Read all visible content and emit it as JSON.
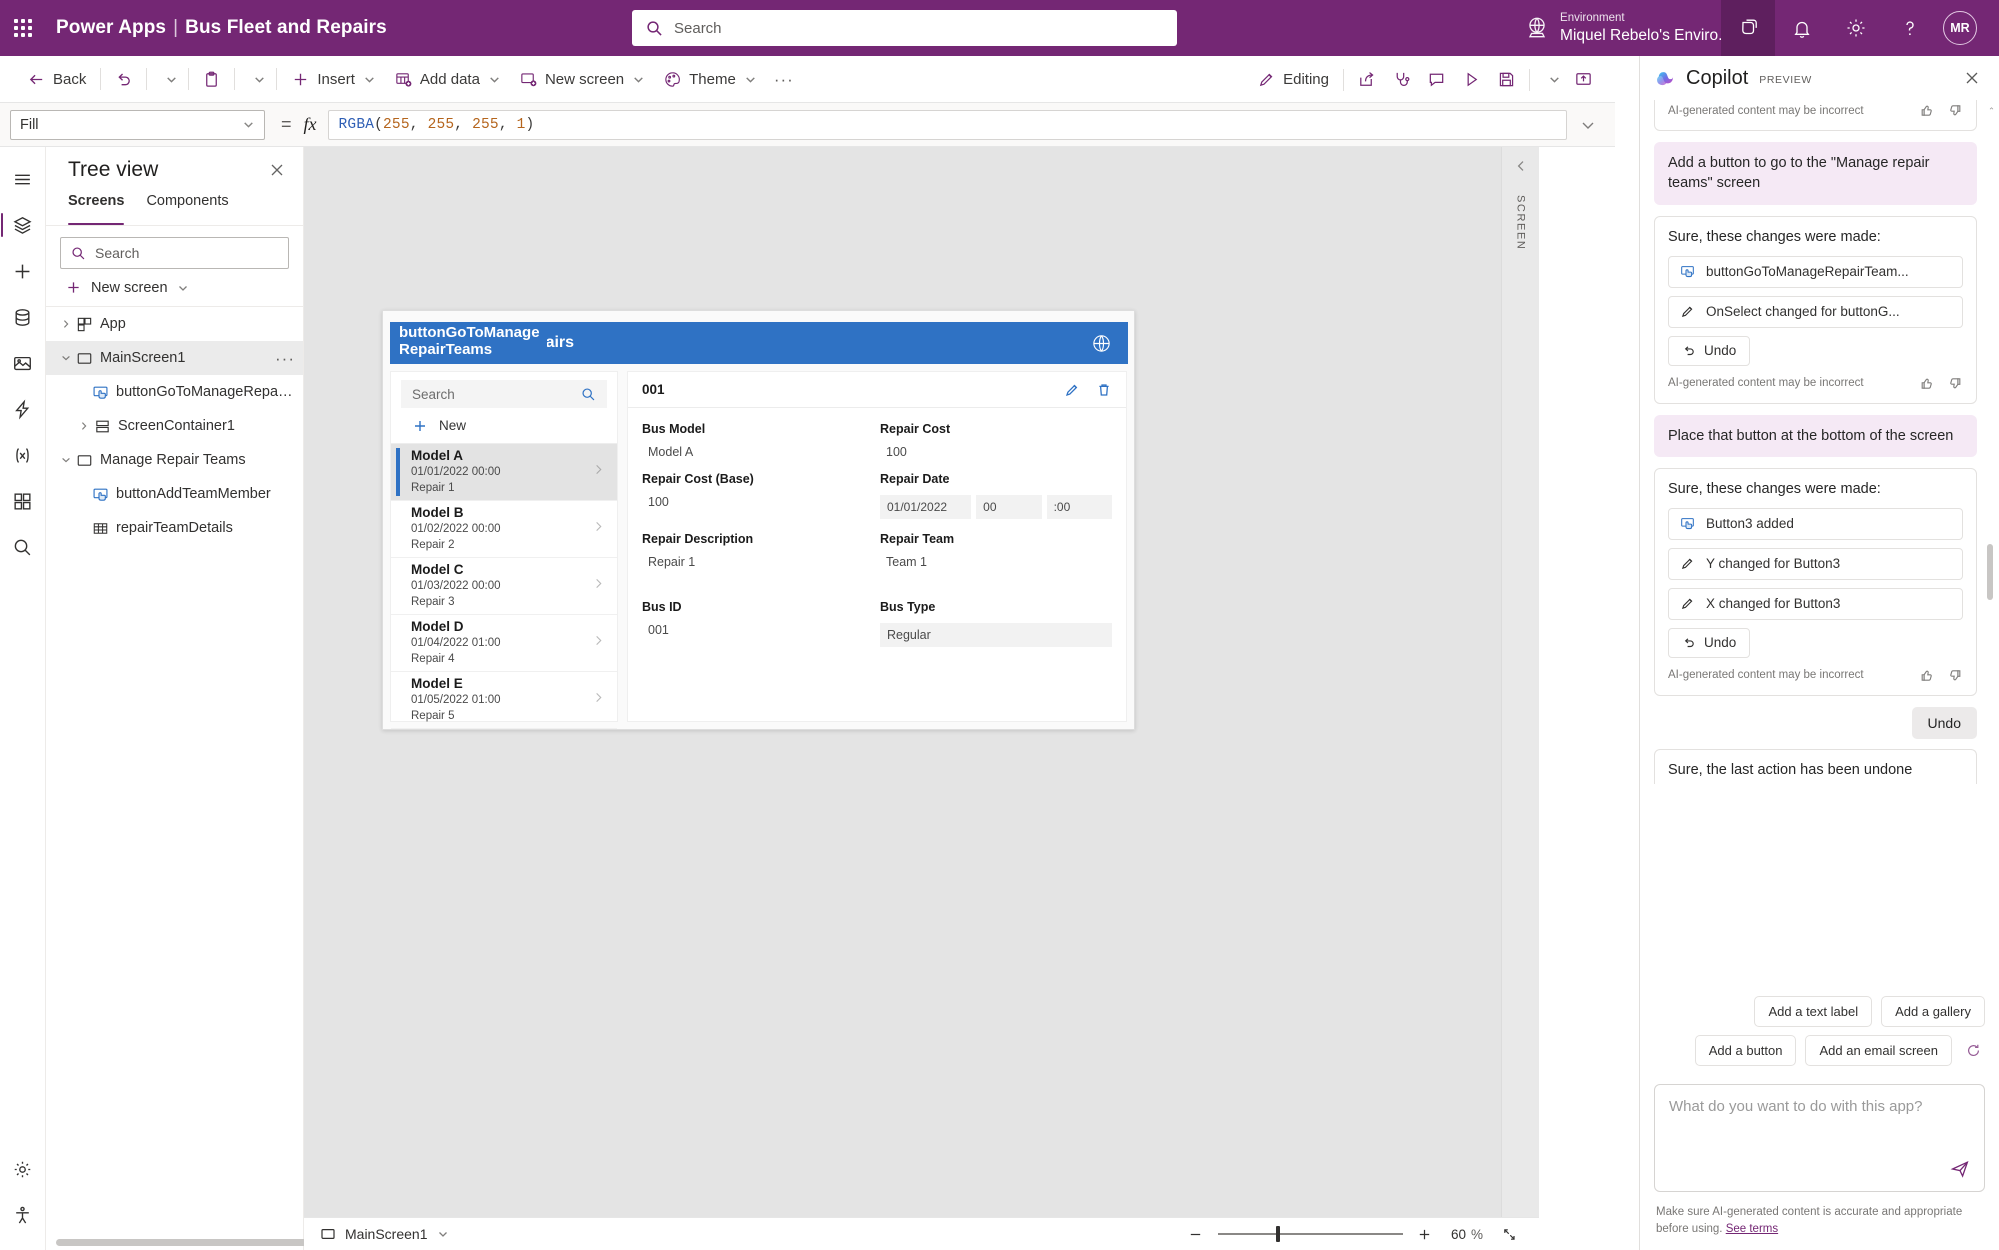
{
  "topbar": {
    "waffle_label": "app-launcher",
    "product": "Power Apps",
    "separator": "|",
    "app_name": "Bus Fleet and Repairs",
    "search_placeholder": "Search",
    "environment_label": "Environment",
    "environment_name": "Miquel Rebelo's Enviro...",
    "avatar_initials": "MR"
  },
  "commandbar": {
    "back": "Back",
    "insert": "Insert",
    "add_data": "Add data",
    "new_screen": "New screen",
    "theme": "Theme",
    "more": "···",
    "editing": "Editing"
  },
  "formulabar": {
    "property": "Fill",
    "equals": "=",
    "fx": "fx",
    "formula_fn": "RGBA",
    "formula_args": [
      "255",
      "255",
      "255",
      "1"
    ],
    "formula_full": "RGBA(255, 255, 255, 1)"
  },
  "treeview": {
    "title": "Tree view",
    "tabs": [
      {
        "label": "Screens",
        "selected": true
      },
      {
        "label": "Components",
        "selected": false
      }
    ],
    "search_placeholder": "Search",
    "new_screen": "New screen",
    "nodes": [
      {
        "label": "App",
        "depth": 0,
        "icon": "app-icon",
        "arrow": "collapsed",
        "selected": false,
        "menu": false
      },
      {
        "label": "MainScreen1",
        "depth": 0,
        "icon": "screen-icon",
        "arrow": "expanded",
        "selected": true,
        "menu": true
      },
      {
        "label": "buttonGoToManageRepairTeams",
        "depth": 2,
        "icon": "button-icon",
        "arrow": "none",
        "selected": false,
        "menu": false
      },
      {
        "label": "ScreenContainer1",
        "depth": 1,
        "icon": "container-icon",
        "arrow": "collapsed",
        "selected": false,
        "menu": false
      },
      {
        "label": "Manage Repair Teams",
        "depth": 0,
        "icon": "screen-icon",
        "arrow": "expanded",
        "selected": false,
        "menu": false
      },
      {
        "label": "buttonAddTeamMember",
        "depth": 2,
        "icon": "button-icon",
        "arrow": "none",
        "selected": false,
        "menu": false
      },
      {
        "label": "repairTeamDetails",
        "depth": 2,
        "icon": "table-icon",
        "arrow": "none",
        "selected": false,
        "menu": false
      }
    ]
  },
  "canvas": {
    "collapse_label": "SCREEN",
    "app_header_title": "Bus Fleet and Repairs",
    "selected_control_label": "buttonGoToManageRepairTeams",
    "gallery": {
      "search_placeholder": "Search",
      "new_label": "New",
      "items": [
        {
          "title": "Model A",
          "date": "01/01/2022 00:00",
          "repair": "Repair 1",
          "selected": true
        },
        {
          "title": "Model B",
          "date": "01/02/2022 00:00",
          "repair": "Repair 2",
          "selected": false
        },
        {
          "title": "Model C",
          "date": "01/03/2022 00:00",
          "repair": "Repair 3",
          "selected": false
        },
        {
          "title": "Model D",
          "date": "01/04/2022 01:00",
          "repair": "Repair 4",
          "selected": false
        },
        {
          "title": "Model E",
          "date": "01/05/2022 01:00",
          "repair": "Repair 5",
          "selected": false
        }
      ]
    },
    "form": {
      "record_id": "001",
      "fields": [
        {
          "label": "Bus Model",
          "value": "Model A",
          "style": "plain"
        },
        {
          "label": "Repair Cost",
          "value": "100",
          "style": "plain"
        },
        {
          "label": "Repair Cost (Base)",
          "value": "100",
          "style": "plain"
        },
        {
          "label": "Repair Date",
          "value": "01/01/2022",
          "style": "date",
          "hour": "00",
          "minute": ":00"
        },
        {
          "label": "Repair Description",
          "value": "Repair 1",
          "style": "plain"
        },
        {
          "label": "Repair Team",
          "value": "Team 1",
          "style": "plain"
        },
        {
          "label": "Bus ID",
          "value": "001",
          "style": "plain"
        },
        {
          "label": "Bus Type",
          "value": "Regular",
          "style": "filled"
        }
      ]
    }
  },
  "canvas_footer": {
    "screen_name": "MainScreen1",
    "zoom_value": "60",
    "zoom_unit": "%"
  },
  "copilot": {
    "title": "Copilot",
    "badge": "PREVIEW",
    "disclaimer": "AI-generated content may be incorrect",
    "messages": [
      {
        "kind": "partial_card",
        "disclaimer": "AI-generated content may be incorrect"
      },
      {
        "kind": "user",
        "text": "Add a button to go to the \"Manage repair teams\" screen"
      },
      {
        "kind": "assistant",
        "heading": "Sure, these changes were made:",
        "changes": [
          {
            "icon": "button-icon",
            "text": "buttonGoToManageRepairTeam..."
          },
          {
            "icon": "pencil-icon",
            "text": "OnSelect changed for buttonG..."
          }
        ],
        "undo": "Undo",
        "disclaimer": "AI-generated content may be incorrect"
      },
      {
        "kind": "user",
        "text": "Place that button at the bottom of the screen"
      },
      {
        "kind": "assistant",
        "heading": "Sure, these changes were made:",
        "changes": [
          {
            "icon": "button-icon",
            "text": "Button3 added"
          },
          {
            "icon": "pencil-icon",
            "text": "Y changed for Button3"
          },
          {
            "icon": "pencil-icon",
            "text": "X changed for Button3"
          }
        ],
        "undo": "Undo",
        "disclaimer": "AI-generated content may be incorrect"
      },
      {
        "kind": "undo_pill",
        "text": "Undo"
      },
      {
        "kind": "assistant_plain",
        "text": "Sure, the last action has been undone"
      }
    ],
    "suggestions_row1": [
      "Add a text label",
      "Add a gallery"
    ],
    "suggestions_row2": [
      "Add a button",
      "Add an email screen"
    ],
    "input_placeholder": "What do you want to do with this app?",
    "footer_text": "Make sure AI-generated content is accurate and appropriate before using.",
    "footer_link": "See terms"
  },
  "colors": {
    "brand_purple": "#742774",
    "accent_blue": "#2f72c4",
    "user_bubble": "#f5e9f5"
  }
}
